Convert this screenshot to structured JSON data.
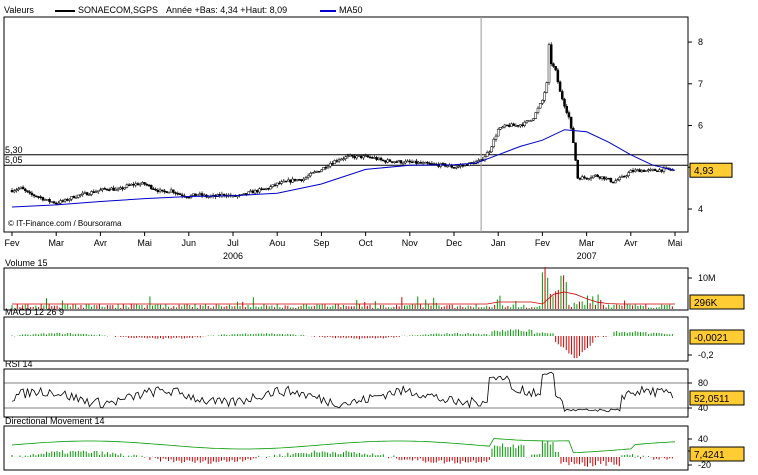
{
  "header": {
    "valeurs_label": "Valeurs",
    "ticker": "SONAECOM,SGPS",
    "range_text": "Année +Bas: 4,34 +Haut: 8,09",
    "ma_label": "MA50"
  },
  "colors": {
    "price": "#000000",
    "ma50": "#0000cc",
    "up": "#009900",
    "down": "#cc0000",
    "current_badge": "#ffcc33",
    "grid": "#cccccc",
    "dm_plus": "#009900",
    "dm_minus": "#cc0000"
  },
  "copyright": "© IT-Finance.com / Boursorama",
  "chart_data": [
    {
      "type": "line",
      "title": "",
      "months": [
        "Fev",
        "Mar",
        "Avr",
        "Mai",
        "Jun",
        "Jul",
        "Aou",
        "Sep",
        "Oct",
        "Nov",
        "Dec",
        "Jan",
        "Fev",
        "Mar",
        "Avr",
        "Mai"
      ],
      "years": [
        {
          "label": "2006",
          "month_index": 5
        },
        {
          "label": "2007",
          "month_index": 13
        }
      ],
      "y_ticks": [
        4,
        5,
        6,
        7,
        8
      ],
      "ylim": [
        3.45,
        8.6
      ],
      "reference_lines": [
        {
          "label": "5,30",
          "value": 5.3
        },
        {
          "label": "5,05",
          "value": 5.05
        }
      ],
      "current_value": "4,93",
      "price_series": [
        [
          0,
          4.45
        ],
        [
          0.2,
          4.5
        ],
        [
          0.4,
          4.35
        ],
        [
          0.6,
          4.3
        ],
        [
          0.8,
          4.2
        ],
        [
          1.0,
          4.15
        ],
        [
          1.2,
          4.2
        ],
        [
          1.4,
          4.3
        ],
        [
          1.6,
          4.35
        ],
        [
          1.8,
          4.4
        ],
        [
          2.0,
          4.45
        ],
        [
          2.2,
          4.5
        ],
        [
          2.4,
          4.45
        ],
        [
          2.6,
          4.55
        ],
        [
          2.8,
          4.6
        ],
        [
          3.0,
          4.6
        ],
        [
          3.2,
          4.5
        ],
        [
          3.4,
          4.4
        ],
        [
          3.6,
          4.45
        ],
        [
          3.8,
          4.35
        ],
        [
          4.0,
          4.3
        ],
        [
          4.2,
          4.35
        ],
        [
          4.4,
          4.3
        ],
        [
          4.6,
          4.3
        ],
        [
          4.8,
          4.35
        ],
        [
          5.0,
          4.3
        ],
        [
          5.2,
          4.32
        ],
        [
          5.4,
          4.4
        ],
        [
          5.6,
          4.45
        ],
        [
          5.8,
          4.5
        ],
        [
          6.0,
          4.6
        ],
        [
          6.2,
          4.65
        ],
        [
          6.4,
          4.7
        ],
        [
          6.6,
          4.72
        ],
        [
          6.8,
          4.85
        ],
        [
          7.0,
          4.95
        ],
        [
          7.2,
          5.1
        ],
        [
          7.4,
          5.2
        ],
        [
          7.6,
          5.25
        ],
        [
          7.8,
          5.25
        ],
        [
          8.0,
          5.25
        ],
        [
          8.2,
          5.22
        ],
        [
          8.4,
          5.15
        ],
        [
          8.6,
          5.15
        ],
        [
          8.8,
          5.13
        ],
        [
          9.0,
          5.12
        ],
        [
          9.2,
          5.1
        ],
        [
          9.4,
          5.08
        ],
        [
          9.6,
          5.06
        ],
        [
          9.8,
          5.05
        ],
        [
          10.0,
          5.0
        ],
        [
          10.2,
          5.05
        ],
        [
          10.4,
          5.1
        ],
        [
          10.6,
          5.15
        ],
        [
          10.8,
          5.4
        ],
        [
          11.0,
          5.9
        ],
        [
          11.2,
          6.0
        ],
        [
          11.4,
          6.0
        ],
        [
          11.6,
          6.05
        ],
        [
          11.8,
          6.2
        ],
        [
          11.9,
          6.4
        ],
        [
          12.0,
          6.6
        ],
        [
          12.1,
          7.0
        ],
        [
          12.15,
          7.9
        ],
        [
          12.2,
          7.5
        ],
        [
          12.3,
          7.3
        ],
        [
          12.4,
          6.8
        ],
        [
          12.5,
          6.5
        ],
        [
          12.6,
          6.2
        ],
        [
          12.7,
          5.6
        ],
        [
          12.8,
          4.75
        ],
        [
          13.0,
          4.75
        ],
        [
          13.2,
          4.8
        ],
        [
          13.4,
          4.75
        ],
        [
          13.6,
          4.65
        ],
        [
          13.8,
          4.75
        ],
        [
          14.0,
          4.9
        ],
        [
          14.2,
          4.93
        ],
        [
          14.4,
          4.92
        ],
        [
          14.6,
          4.93
        ],
        [
          14.8,
          4.95
        ],
        [
          15.0,
          4.93
        ]
      ],
      "ma50_series": [
        [
          0,
          4.05
        ],
        [
          1,
          4.1
        ],
        [
          2,
          4.18
        ],
        [
          3,
          4.25
        ],
        [
          4,
          4.3
        ],
        [
          5,
          4.32
        ],
        [
          6,
          4.38
        ],
        [
          7,
          4.6
        ],
        [
          8,
          4.95
        ],
        [
          9,
          5.05
        ],
        [
          10,
          5.06
        ],
        [
          10.5,
          5.1
        ],
        [
          11,
          5.3
        ],
        [
          11.5,
          5.5
        ],
        [
          12,
          5.65
        ],
        [
          12.5,
          5.9
        ],
        [
          13,
          5.85
        ],
        [
          13.5,
          5.6
        ],
        [
          14,
          5.3
        ],
        [
          14.5,
          5.05
        ],
        [
          15,
          4.93
        ]
      ]
    },
    {
      "type": "bar",
      "title": "Volume 15",
      "y_ticks": [
        "10M"
      ],
      "current_value": "296K"
    },
    {
      "type": "bar",
      "title": "MACD 12 26 9",
      "y_ticks": [
        "-0,2"
      ],
      "current_value": "-0,0021"
    },
    {
      "type": "line",
      "title": "RSI 14",
      "y_ticks": [
        "80",
        "40"
      ],
      "current_value": "52,0511"
    },
    {
      "type": "line",
      "title": "Directional Movement 14",
      "y_ticks": [
        "40",
        "20",
        "-20"
      ],
      "current_value": "7,4241"
    }
  ]
}
